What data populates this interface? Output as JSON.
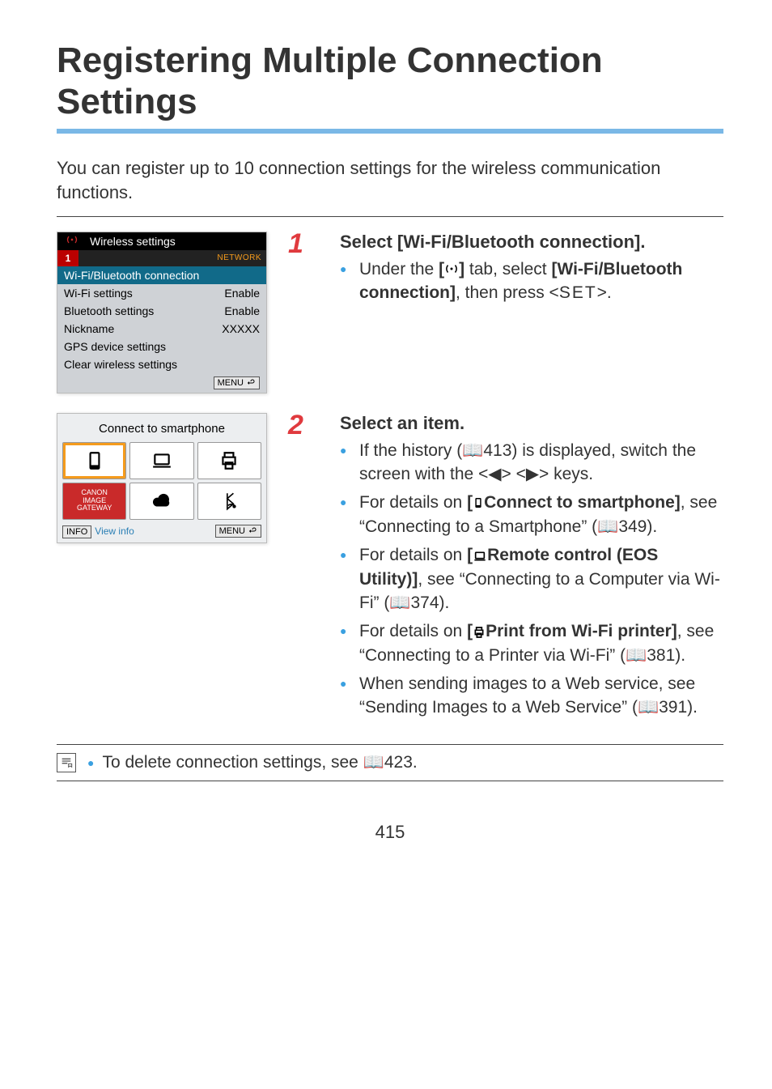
{
  "title": "Registering Multiple Connection Settings",
  "intro": "You can register up to 10 connection settings for the wireless communication functions.",
  "screenshot1": {
    "header": "Wireless settings",
    "tab": "1",
    "network": "NETWORK",
    "rows": [
      {
        "label": "Wi-Fi/Bluetooth connection",
        "value": "",
        "selected": true
      },
      {
        "label": "Wi-Fi settings",
        "value": "Enable"
      },
      {
        "label": "Bluetooth settings",
        "value": "Enable"
      },
      {
        "label": "Nickname",
        "value": "XXXXX"
      },
      {
        "label": "GPS device settings",
        "value": ""
      },
      {
        "label": "Clear wireless settings",
        "value": ""
      }
    ],
    "menu": "MENU"
  },
  "screenshot2": {
    "title": "Connect to smartphone",
    "info": "INFO",
    "viewinfo": "View info",
    "menu": "MENU",
    "image_gateway": "CANON\nIMAGE\nGATEWAY"
  },
  "step1": {
    "num": "1",
    "head": "Select [Wi-Fi/Bluetooth connection].",
    "bullet_pre": "Under the ",
    "bullet_mid": " tab, select ",
    "bullet_bold": "[Wi-Fi/Bluetooth connection]",
    "bullet_post1": ", then press <",
    "set": "SET",
    "bullet_post2": ">."
  },
  "step2": {
    "num": "2",
    "head": "Select an item.",
    "b1a": "If the history (",
    "b1p": "413) is displayed, switch the screen with the <◀> <▶> keys.",
    "b2a": "For details on ",
    "b2bold": "Connect to smartphone]",
    "b2b": ", see “Connecting to a Smartphone” (",
    "b2p": "349).",
    "b3a": "For details on ",
    "b3bold": "Remote control (EOS Utility)]",
    "b3b": ", see “Connecting to a Computer via Wi-Fi” (",
    "b3p": "374).",
    "b4a": "For details on ",
    "b4bold": "Print from Wi-Fi printer]",
    "b4b": ", see “Connecting to a Printer via Wi-Fi” (",
    "b4p": "381).",
    "b5a": "When sending images to a Web service, see “Sending Images to a Web Service” (",
    "b5p": "391)."
  },
  "footer": {
    "pre": "To delete connection settings, see ",
    "page": "423."
  },
  "page_number": "415",
  "bracket_open": "[",
  "bracket_close": "]"
}
